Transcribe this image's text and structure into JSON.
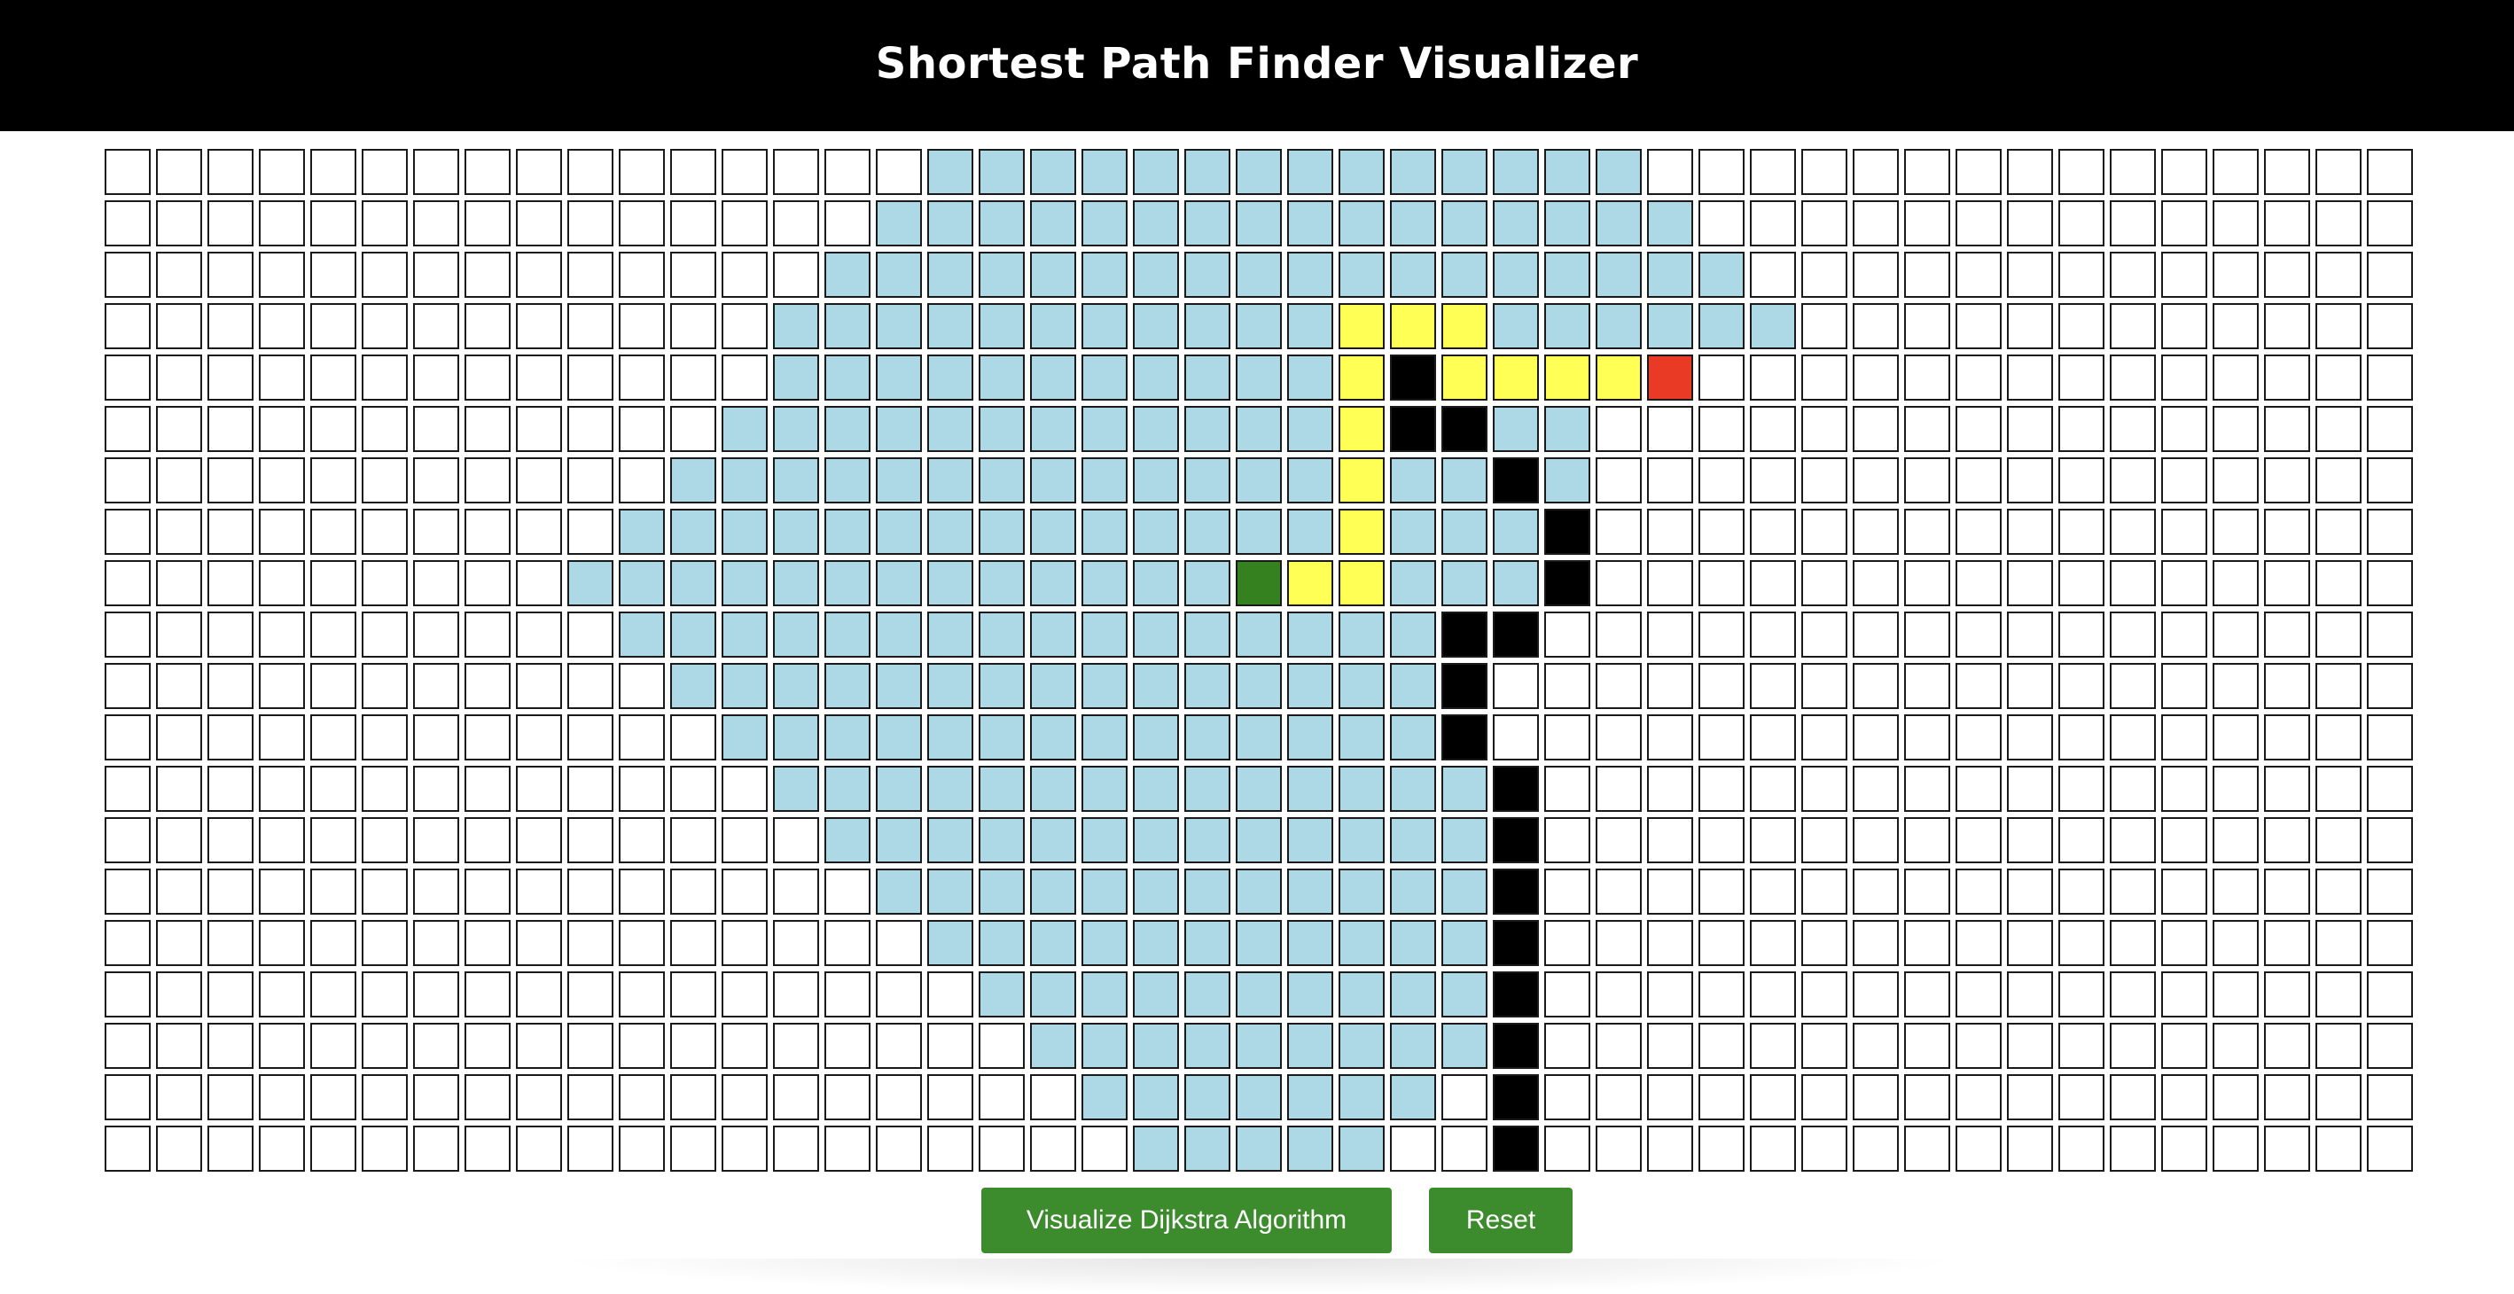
{
  "header": {
    "title": "Shortest Path Finder Visualizer"
  },
  "controls": {
    "visualize_label": "Visualize Dijkstra Algorithm",
    "reset_label": "Reset"
  },
  "colors": {
    "header_bg": "#000000",
    "unvisited": "#ffffff",
    "visited": "#add8e6",
    "wall": "#000000",
    "path": "#ffff55",
    "start": "#35801f",
    "end": "#e83a24",
    "button": "#3c8c2d"
  },
  "grid": {
    "rows": 20,
    "cols": 45,
    "start": [
      8,
      22
    ],
    "end": [
      4,
      30
    ],
    "visited_ranges": [
      [
        [
          16,
          29
        ]
      ],
      [
        [
          15,
          30
        ]
      ],
      [
        [
          14,
          31
        ]
      ],
      [
        [
          13,
          32
        ]
      ],
      [
        [
          13,
          29
        ]
      ],
      [
        [
          12,
          28
        ]
      ],
      [
        [
          11,
          28
        ]
      ],
      [
        [
          10,
          28
        ]
      ],
      [
        [
          9,
          28
        ]
      ],
      [
        [
          10,
          26
        ]
      ],
      [
        [
          11,
          26
        ]
      ],
      [
        [
          12,
          26
        ]
      ],
      [
        [
          13,
          26
        ]
      ],
      [
        [
          14,
          26
        ]
      ],
      [
        [
          15,
          26
        ]
      ],
      [
        [
          16,
          26
        ]
      ],
      [
        [
          17,
          26
        ]
      ],
      [
        [
          18,
          26
        ]
      ],
      [
        [
          19,
          25
        ]
      ],
      [
        [
          20,
          24
        ]
      ]
    ],
    "walls": [
      [
        4,
        25
      ],
      [
        5,
        25
      ],
      [
        5,
        26
      ],
      [
        6,
        27
      ],
      [
        7,
        28
      ],
      [
        8,
        28
      ],
      [
        9,
        26
      ],
      [
        9,
        27
      ],
      [
        10,
        26
      ],
      [
        11,
        26
      ],
      [
        12,
        27
      ],
      [
        13,
        27
      ],
      [
        14,
        27
      ],
      [
        15,
        27
      ],
      [
        16,
        27
      ],
      [
        17,
        27
      ],
      [
        18,
        27
      ],
      [
        19,
        27
      ]
    ],
    "path": [
      [
        8,
        23
      ],
      [
        8,
        24
      ],
      [
        7,
        24
      ],
      [
        6,
        24
      ],
      [
        5,
        24
      ],
      [
        4,
        24
      ],
      [
        3,
        24
      ],
      [
        3,
        25
      ],
      [
        3,
        26
      ],
      [
        4,
        26
      ],
      [
        4,
        27
      ],
      [
        4,
        28
      ],
      [
        4,
        29
      ]
    ]
  }
}
